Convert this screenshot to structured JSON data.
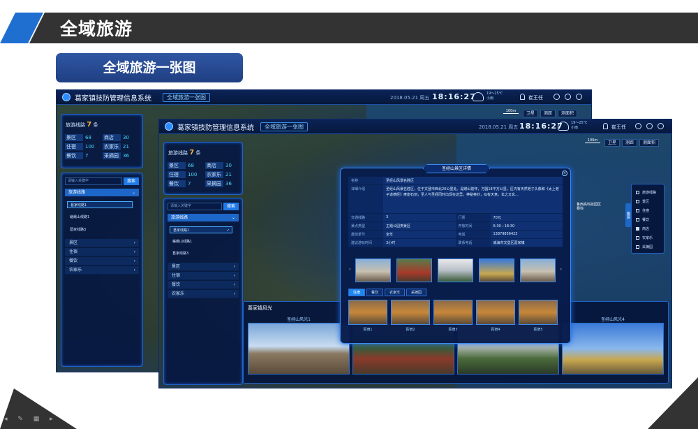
{
  "slide": {
    "title": "全域旅游",
    "subtitle": "全域旅游一张图"
  },
  "app": {
    "system_title": "葛家镇技防管理信息系统",
    "active_tab": "全域旅游一张图",
    "date": "2018.05.21 周五",
    "time": "18:16:27",
    "weather": {
      "temp": "19～25℃",
      "desc": "小雨",
      "icon": "cloud-rain-icon"
    },
    "user": "崔王任",
    "tools": [
      "卫星",
      "测距",
      "测面积"
    ],
    "scale_label": "100m"
  },
  "stats": {
    "routes_label": "旅游线路",
    "routes_count": "7",
    "routes_unit": "条",
    "items": [
      {
        "k": "景区",
        "v": "68"
      },
      {
        "k": "商店",
        "v": "30"
      },
      {
        "k": "住宿",
        "v": "100"
      },
      {
        "k": "农家乐",
        "v": "21"
      },
      {
        "k": "餐饮",
        "v": "7"
      },
      {
        "k": "采摘园",
        "v": "36"
      }
    ]
  },
  "sidebar": {
    "search_placeholder": "请输入关键字",
    "search_button": "搜索",
    "group_label": "旅游线路",
    "routes": [
      "葛家线路1",
      "嵯峨山线路1",
      "葛家线路3"
    ],
    "categories": [
      "景区",
      "住宿",
      "餐饮",
      "农家乐"
    ]
  },
  "gallery": {
    "title": "葛家镇风光",
    "photos": [
      "圣经山风光1",
      "",
      "",
      "圣经山风光4"
    ]
  },
  "layers": {
    "tab": "图层",
    "items": [
      {
        "label": "旅游线路",
        "checked": false
      },
      {
        "label": "景区",
        "checked": false
      },
      {
        "label": "住宿",
        "checked": false
      },
      {
        "label": "餐饮",
        "checked": false
      },
      {
        "label": "商店",
        "checked": true
      },
      {
        "label": "农家乐",
        "checked": false
      },
      {
        "label": "采摘园",
        "checked": false
      }
    ]
  },
  "map_labels": [
    "鲁西高科技园区",
    "赛科"
  ],
  "detail": {
    "title": "圣经山景区详情",
    "name_label": "名称",
    "name": "圣经山风景名胜区",
    "intro_label": "详细介绍",
    "intro": "圣经山风景名胜区，位于文登市西北20公里处。是崂山前怀，方圆18平方公里。区内有天然老子头像和《太上老子道德经》摩崖石刻，圣人与圣经同时出现在这里。神秘奥妙，似有天意，玄之又玄...",
    "rows": [
      {
        "k1": "交通线路",
        "v1": "3",
        "k2": "门票",
        "v2": "70元"
      },
      {
        "k1": "景点类型",
        "v1": "主题公园类景区",
        "k2": "开放时间",
        "v2": "6:30－18:30"
      },
      {
        "k1": "最佳季节",
        "v1": "全年",
        "k2": "电话",
        "v2": "13879856423"
      },
      {
        "k1": "建议游玩时间",
        "v1": "3小时",
        "k2": "联系电话",
        "v2": "威海市文登区葛家镇"
      }
    ],
    "tabs": [
      "住宿",
      "餐饮",
      "农家乐",
      "采摘园"
    ],
    "nearby": [
      "民宿1",
      "民宿2",
      "民宿3",
      "民宿4",
      "民宿5"
    ]
  }
}
